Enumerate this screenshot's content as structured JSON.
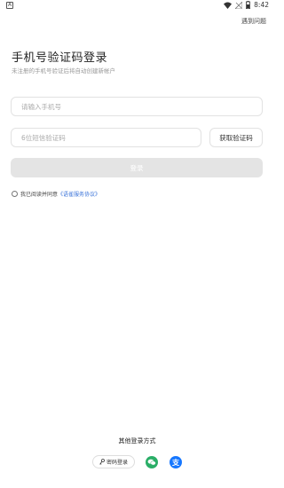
{
  "status_bar": {
    "left_glyph": "A",
    "time": "8:42"
  },
  "header": {
    "help_link": "遇到问题"
  },
  "main": {
    "title": "手机号验证码登录",
    "subtitle": "未注册的手机号验证后将自动创建新帐户",
    "phone_placeholder": "请输入手机号",
    "code_placeholder": "6位短信验证码",
    "get_code_label": "获取验证码",
    "login_label": "登录",
    "agree_prefix": "我已阅读并同意",
    "agree_link": "《语雀服务协议》"
  },
  "footer": {
    "other_title": "其他登录方式",
    "password_login": "密码登录",
    "icons": [
      "wechat-icon",
      "alipay-icon"
    ],
    "alipay_glyph": "支"
  },
  "colors": {
    "link": "#3a73d9",
    "wechat": "#2aae67",
    "alipay": "#1677ff",
    "disabled_button": "#e4e4e4"
  }
}
